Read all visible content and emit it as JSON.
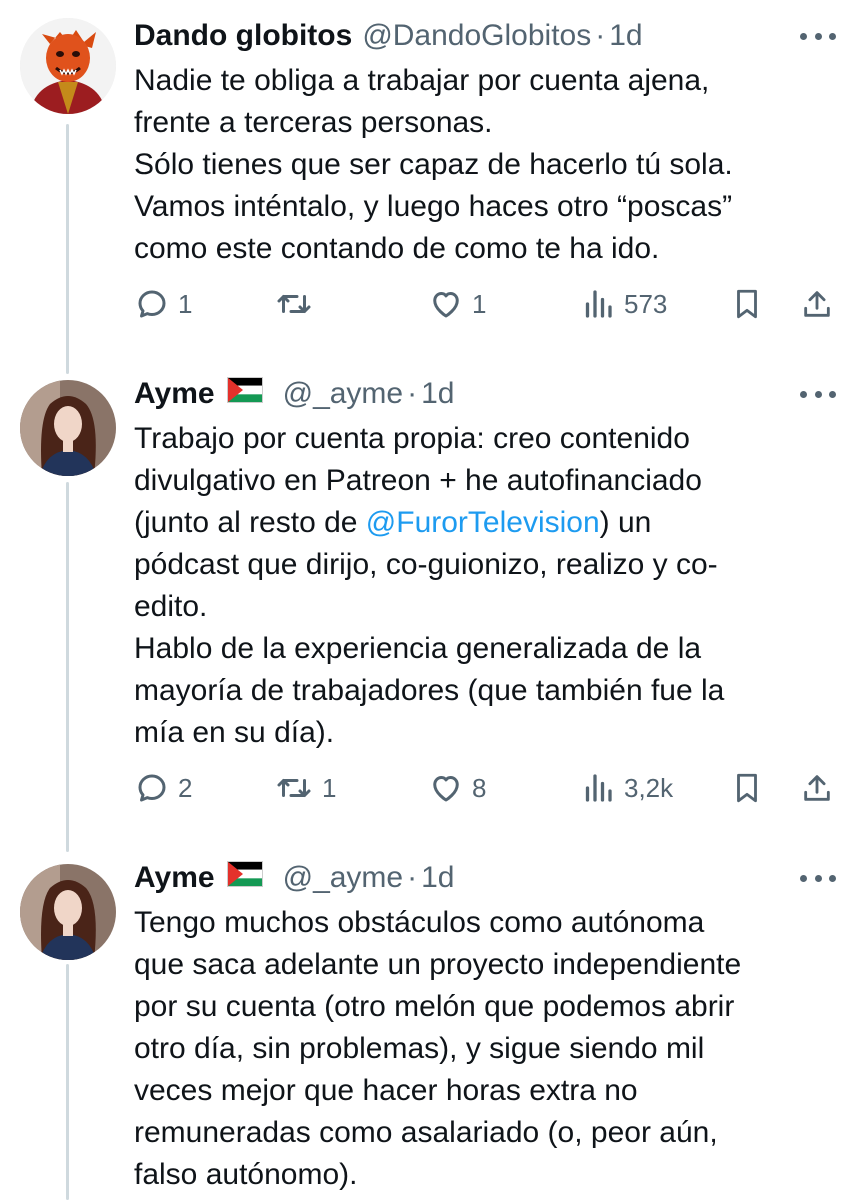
{
  "tweets": [
    {
      "name": "Dando globitos",
      "handle": "@DandoGlobitos",
      "separator": "·",
      "time": "1d",
      "flag": false,
      "text": {
        "lines": [
          "Nadie te obliga a trabajar por cuenta ajena,",
          "frente a terceras personas.",
          "Sólo tienes que ser capaz de hacerlo tú sola.",
          "Vamos inténtalo, y luego haces otro “poscas”",
          "como este contando de como te ha ido."
        ]
      },
      "actions": {
        "replies": "1",
        "reposts": "",
        "likes": "1",
        "views": "573"
      }
    },
    {
      "name": "Ayme",
      "handle": "@_ayme",
      "separator": "·",
      "time": "1d",
      "flag": true,
      "text": {
        "line1": "Trabajo por cuenta propia: creo contenido",
        "line2": "divulgativo en Patreon + he autofinanciado",
        "line3_pre": "(junto al resto de ",
        "line3_mention": "@FurorTelevision",
        "line3_post": ") un",
        "line4": "pódcast que dirijo, co-guionizo, realizo y co-",
        "line5": "edito.",
        "line6": "Hablo de la experiencia generalizada de la",
        "line7": "mayoría de trabajadores (que también fue la",
        "line8": "mía en su día)."
      },
      "actions": {
        "replies": "2",
        "reposts": "1",
        "likes": "8",
        "views": "3,2k"
      }
    },
    {
      "name": "Ayme",
      "handle": "@_ayme",
      "separator": "·",
      "time": "1d",
      "flag": true,
      "text": {
        "lines": [
          "Tengo muchos obstáculos como autónoma",
          "que saca adelante un proyecto independiente",
          "por su cuenta (otro melón que podemos abrir",
          "otro día, sin problemas), y sigue siendo mil",
          "veces mejor que hacer horas extra no",
          "remuneradas como asalariado (o, peor aún,",
          "falso autónomo)."
        ]
      }
    }
  ],
  "icons": {
    "reply": "reply-icon",
    "repost": "repost-icon",
    "like": "heart-icon",
    "views": "views-icon",
    "bookmark": "bookmark-icon",
    "share": "share-icon",
    "more": "more-icon"
  },
  "colors": {
    "text": "#0f1419",
    "secondary": "#536471",
    "mention": "#1d9bf0",
    "thread_line": "#cfd9de"
  }
}
